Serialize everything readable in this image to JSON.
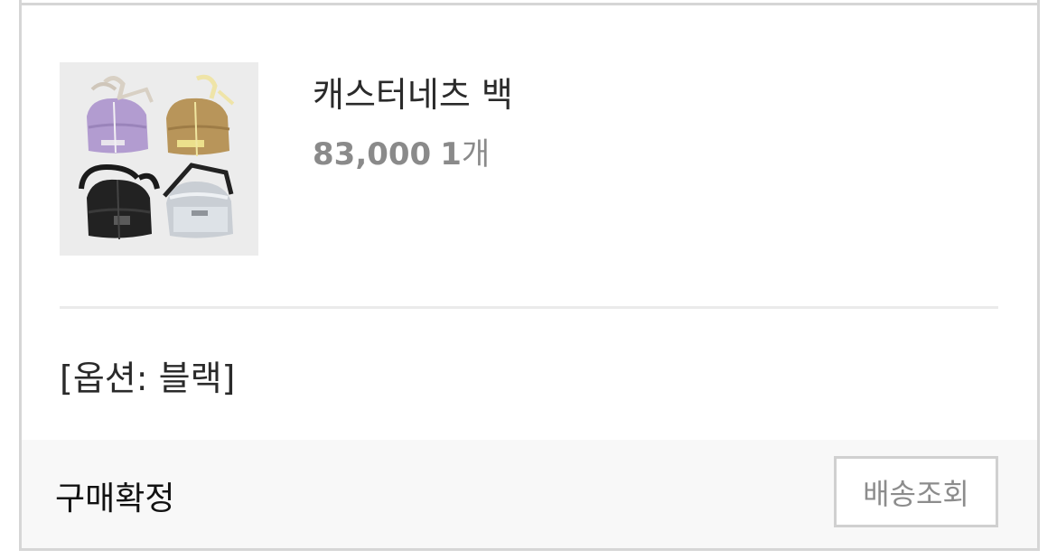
{
  "product": {
    "name": "캐스터네츠 백",
    "price": "83,000",
    "quantity_number": "1",
    "quantity_unit": "개",
    "thumbnail": "product-thumbnail"
  },
  "option": {
    "text": "[옵션: 블랙]"
  },
  "footer": {
    "status": "구매확정",
    "track_button_label": "배송조회"
  },
  "colors": {
    "border": "#d6d6d6",
    "footer_bg": "#f8f8f8",
    "price_text": "#8a8a8a"
  }
}
